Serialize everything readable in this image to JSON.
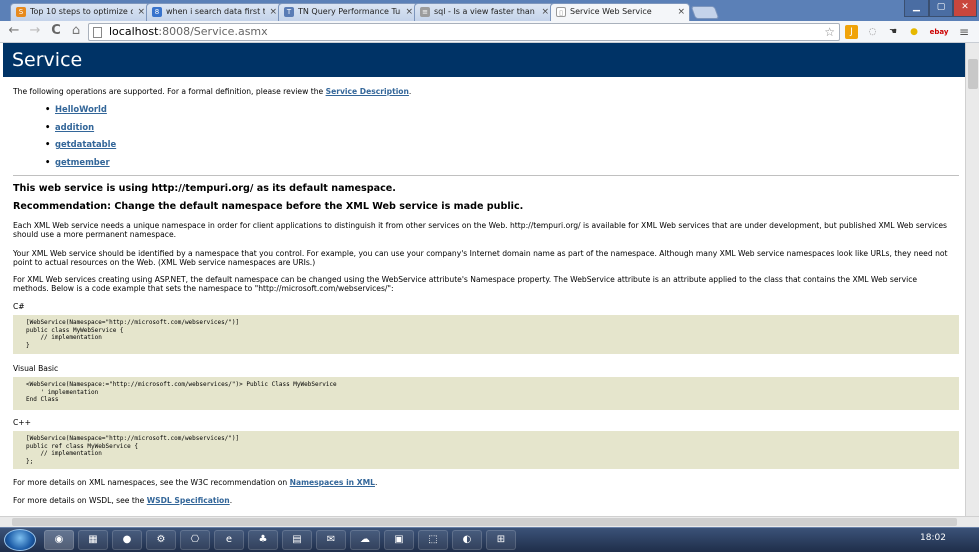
{
  "tabs": [
    {
      "title": "Top 10 steps to optimize d",
      "icon": "S",
      "color": "#e78a1e"
    },
    {
      "title": "when i search data first tim",
      "icon": "8",
      "color": "#3873cc"
    },
    {
      "title": "TN Query Performance Tunin",
      "icon": "T",
      "color": "#5a7cb5"
    },
    {
      "title": "sql - Is a view faster than a",
      "icon": "≡",
      "color": "#9c9c9c"
    },
    {
      "title": "Service Web Service",
      "icon": "▯",
      "color": "#ffffff"
    }
  ],
  "tab_close": "×",
  "window": {
    "minimize": "▁",
    "maximize": "▢",
    "close": "✕"
  },
  "toolbar": {
    "back": "←",
    "forward": "→",
    "reload": "C",
    "home": "⌂",
    "star": "☆",
    "ext_ebay": "ebay",
    "menu": "≡"
  },
  "address": {
    "host": "localhost",
    "path": ":8008/Service.asmx"
  },
  "page": {
    "title": "Service",
    "intro_prefix": "The following operations are supported. For a formal definition, please review the ",
    "intro_link": "Service Description",
    "intro_suffix": ".",
    "operations": [
      "HelloWorld",
      "addition",
      "getdatatable",
      "getmember"
    ],
    "h_namespace": "This web service is using http://tempuri.org/ as its default namespace.",
    "h_recommend": "Recommendation: Change the default namespace before the XML Web service is made public.",
    "p1": "Each XML Web service needs a unique namespace in order for client applications to distinguish it from other services on the Web. http://tempuri.org/ is available for XML Web services that are under development, but published XML Web services should use a more permanent namespace.",
    "p2": "Your XML Web service should be identified by a namespace that you control. For example, you can use your company's Internet domain name as part of the namespace. Although many XML Web service namespaces look like URLs, they need not point to actual resources on the Web. (XML Web service namespaces are URIs.)",
    "p3": "For XML Web services creating using ASP.NET, the default namespace can be changed using the WebService attribute's Namespace property. The WebService attribute is an attribute applied to the class that contains the XML Web service methods. Below is a code example that sets the namespace to \"http://microsoft.com/webservices/\":",
    "lang_cs": "C#",
    "code_cs": "[WebService(Namespace=\"http://microsoft.com/webservices/\")]\npublic class MyWebService {\n    // implementation\n}",
    "lang_vb": "Visual Basic",
    "code_vb": "<WebService(Namespace:=\"http://microsoft.com/webservices/\")> Public Class MyWebService\n    ' implementation\nEnd Class",
    "lang_cpp": "C++",
    "code_cpp": "[WebService(Namespace=\"http://microsoft.com/webservices/\")]\npublic ref class MyWebService {\n    // implementation\n};",
    "xml_prefix": "For more details on XML namespaces, see the W3C recommendation on ",
    "xml_link": "Namespaces in XML",
    "xml_suffix": ".",
    "wsdl_prefix": "For more details on WSDL, see the ",
    "wsdl_link": "WSDL Specification",
    "wsdl_suffix": "."
  },
  "taskbar": {
    "clock": "18:02",
    "apps": [
      "◉",
      "▦",
      "●",
      "⚙",
      "⎔",
      "e",
      "♣",
      "▤",
      "✉",
      "☁",
      "▣",
      "⬚",
      "◐",
      "⊞"
    ]
  }
}
